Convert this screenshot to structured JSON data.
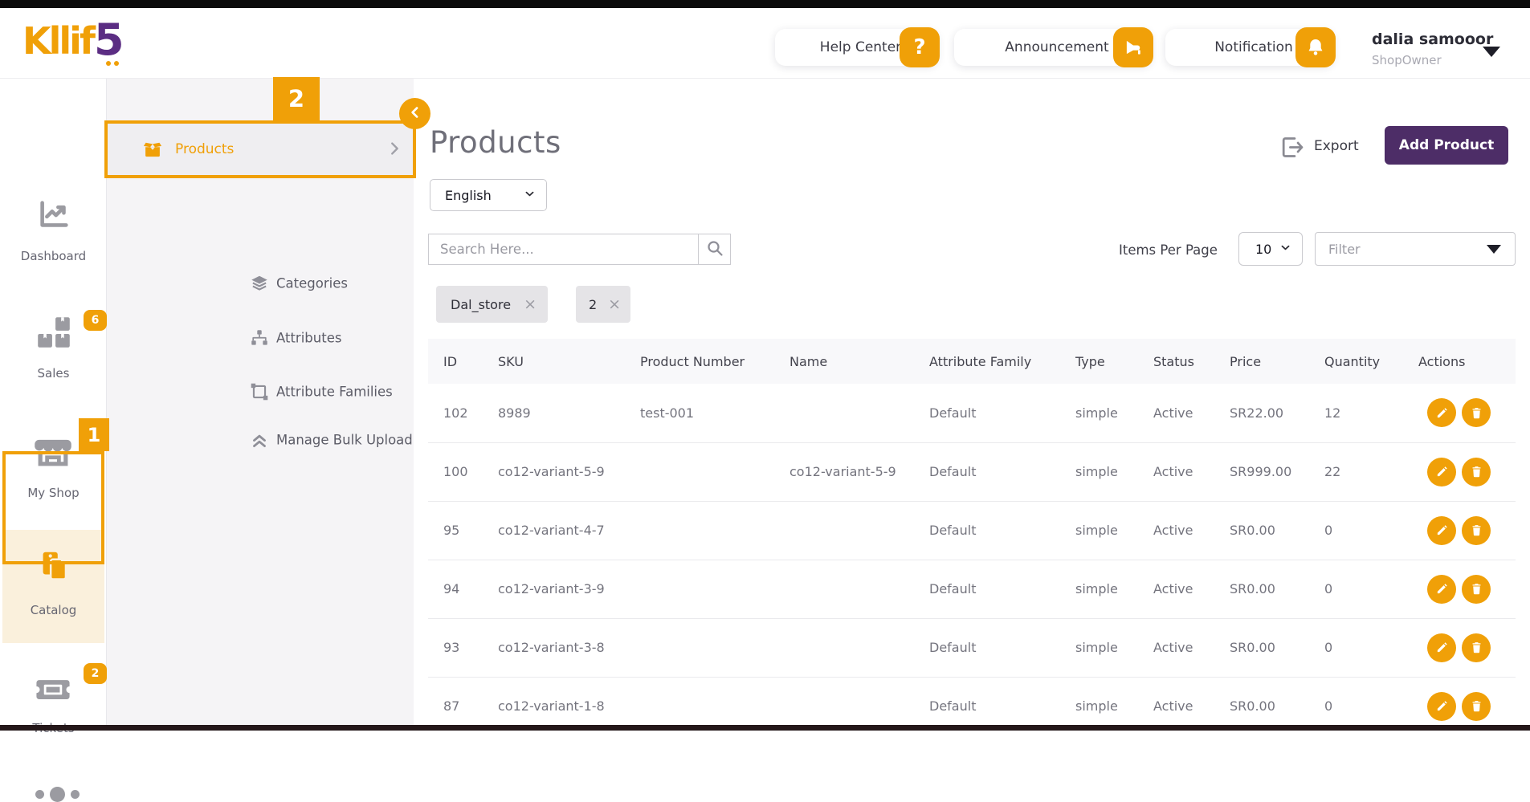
{
  "colors": {
    "accent_orange": "#F0A008",
    "button_purple": "#4D2D67",
    "logo_purple": "#5B2D83",
    "active_item_cream": "#FAF0DC",
    "topbar_black": "#0b0b0b"
  },
  "header": {
    "logo_text": "Kllif",
    "logo_suffix": "5",
    "help_center_label": "Help Center",
    "help_icon_glyph": "?",
    "announcement_label": "Announcement",
    "notification_label": "Notification",
    "user": {
      "name": "dalia samooor",
      "role": "ShopOwner"
    }
  },
  "primary_sidebar": {
    "items": [
      {
        "label": "Dashboard",
        "icon": "chart-line-icon"
      },
      {
        "label": "Sales",
        "icon": "boxes-icon",
        "badge": "6"
      },
      {
        "label": "My Shop",
        "icon": "storefront-icon"
      },
      {
        "label": "Catalog",
        "icon": "clipboard-icon",
        "active": true
      },
      {
        "label": "Tickets",
        "icon": "ticket-icon",
        "badge": "2"
      }
    ]
  },
  "secondary_sidebar": {
    "items": [
      {
        "label": "Products",
        "icon": "open-box-icon",
        "active": true
      },
      {
        "label": "Categories",
        "icon": "layers-icon"
      },
      {
        "label": "Attributes",
        "icon": "sitemap-icon"
      },
      {
        "label": "Attribute Families",
        "icon": "object-group-icon"
      },
      {
        "label": "Manage Bulk Upload",
        "icon": "angles-up-icon"
      }
    ]
  },
  "annotations": {
    "mark1": "1",
    "mark2": "2"
  },
  "main": {
    "title": "Products",
    "export_label": "Export",
    "add_product_label": "Add Product",
    "language_value": "English",
    "search_placeholder": "Search Here...",
    "items_per_page_label": "Items Per Page",
    "items_per_page_value": "10",
    "filter_placeholder": "Filter",
    "chips": [
      {
        "label": "Dal_store",
        "close": "×"
      },
      {
        "label": "2",
        "close": "×"
      }
    ],
    "table": {
      "columns": [
        "ID",
        "SKU",
        "Product Number",
        "Name",
        "Attribute Family",
        "Type",
        "Status",
        "Price",
        "Quantity",
        "Actions"
      ],
      "rows": [
        {
          "id": "102",
          "sku": "8989",
          "product_number": "test-001",
          "name": "",
          "attribute_family": "Default",
          "type": "simple",
          "status": "Active",
          "price": "SR22.00",
          "quantity": "12"
        },
        {
          "id": "100",
          "sku": "co12-variant-5-9",
          "product_number": "",
          "name": "co12-variant-5-9",
          "attribute_family": "Default",
          "type": "simple",
          "status": "Active",
          "price": "SR999.00",
          "quantity": "22"
        },
        {
          "id": "95",
          "sku": "co12-variant-4-7",
          "product_number": "",
          "name": "",
          "attribute_family": "Default",
          "type": "simple",
          "status": "Active",
          "price": "SR0.00",
          "quantity": "0"
        },
        {
          "id": "94",
          "sku": "co12-variant-3-9",
          "product_number": "",
          "name": "",
          "attribute_family": "Default",
          "type": "simple",
          "status": "Active",
          "price": "SR0.00",
          "quantity": "0"
        },
        {
          "id": "93",
          "sku": "co12-variant-3-8",
          "product_number": "",
          "name": "",
          "attribute_family": "Default",
          "type": "simple",
          "status": "Active",
          "price": "SR0.00",
          "quantity": "0"
        },
        {
          "id": "87",
          "sku": "co12-variant-1-8",
          "product_number": "",
          "name": "",
          "attribute_family": "Default",
          "type": "simple",
          "status": "Active",
          "price": "SR0.00",
          "quantity": "0"
        }
      ]
    }
  }
}
